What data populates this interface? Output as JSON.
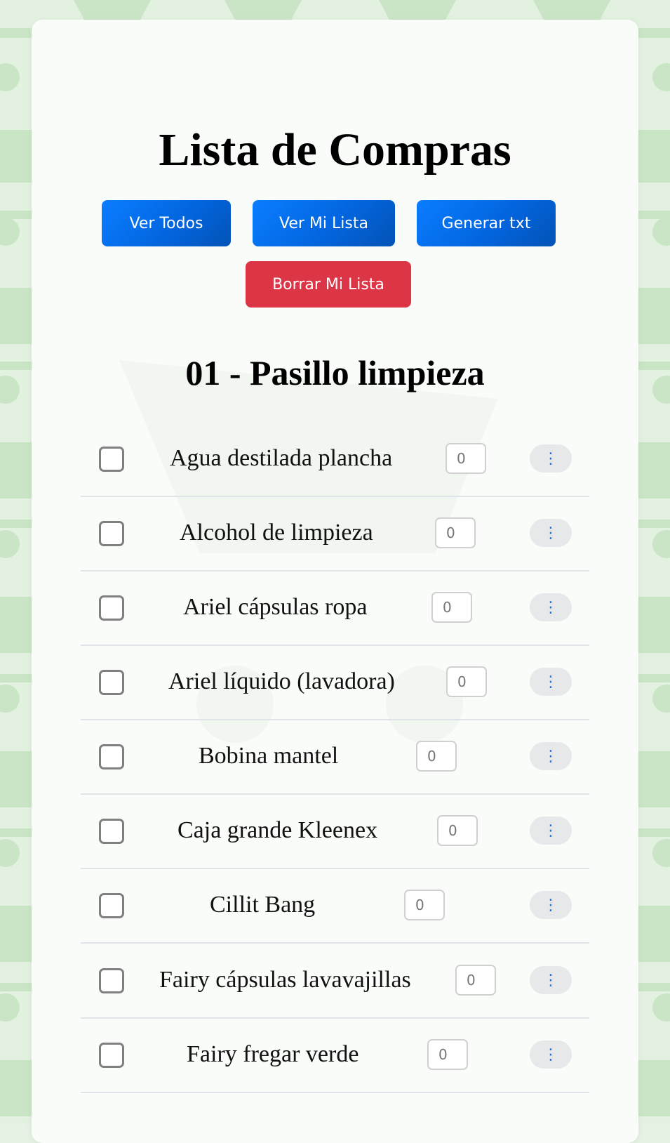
{
  "header": {
    "title": "Lista de Compras"
  },
  "buttons": {
    "ver_todos": "Ver Todos",
    "ver_mi_lista": "Ver Mi Lista",
    "generar_txt": "Generar txt",
    "borrar_mi_lista": "Borrar Mi Lista"
  },
  "section": {
    "title": "01 - Pasillo limpieza"
  },
  "items": [
    {
      "name": "Agua destilada plancha",
      "qty_placeholder": "0",
      "menu_icon": "⋮"
    },
    {
      "name": "Alcohol de limpieza",
      "qty_placeholder": "0",
      "menu_icon": "⋮"
    },
    {
      "name": "Ariel cápsulas ropa",
      "qty_placeholder": "0",
      "menu_icon": "⋮"
    },
    {
      "name": "Ariel líquido (lavadora)",
      "qty_placeholder": "0",
      "menu_icon": "⋮"
    },
    {
      "name": "Bobina mantel",
      "qty_placeholder": "0",
      "menu_icon": "⋮"
    },
    {
      "name": "Caja grande Kleenex",
      "qty_placeholder": "0",
      "menu_icon": "⋮"
    },
    {
      "name": "Cillit Bang",
      "qty_placeholder": "0",
      "menu_icon": "⋮"
    },
    {
      "name": "Fairy cápsulas lavavajillas",
      "qty_placeholder": "0",
      "menu_icon": "⋮"
    },
    {
      "name": "Fairy fregar verde",
      "qty_placeholder": "0",
      "menu_icon": "⋮"
    }
  ],
  "colors": {
    "primary": "#0366e0",
    "danger": "#dc3545",
    "background": "#cde8c9"
  }
}
